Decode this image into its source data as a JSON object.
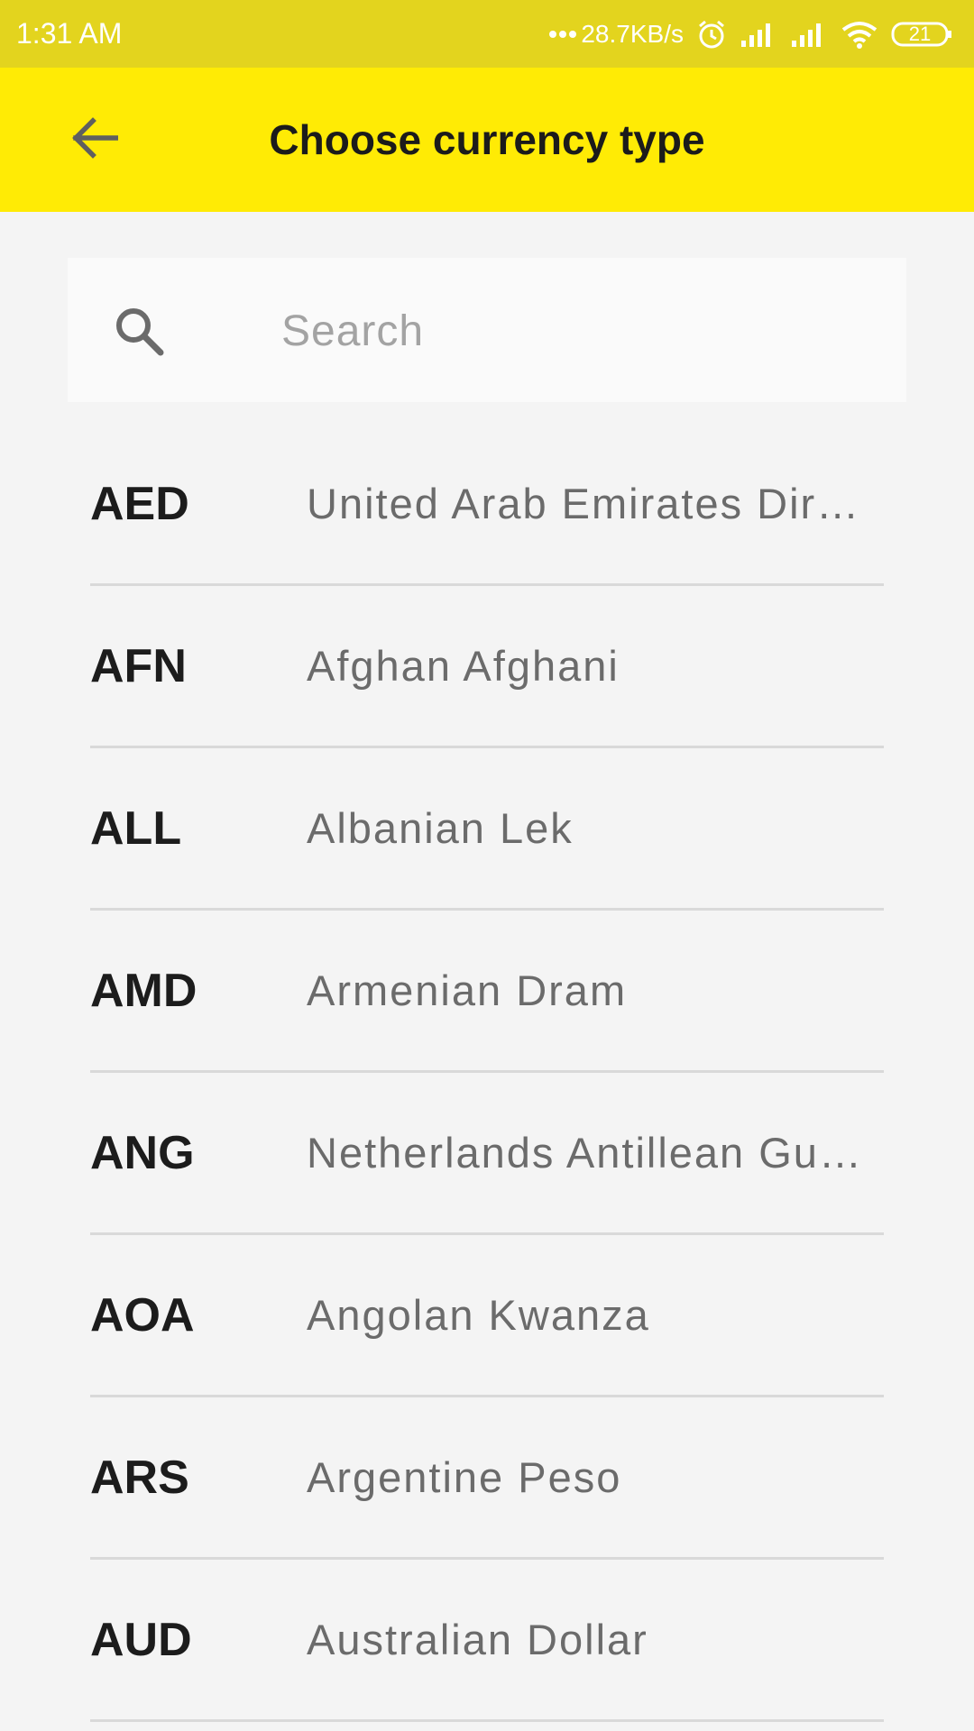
{
  "status_bar": {
    "time": "1:31 AM",
    "network_speed": "28.7KB/s",
    "battery": "21",
    "icons": [
      "dots-icon",
      "alarm-icon",
      "signal-icon",
      "signal-icon",
      "wifi-icon",
      "battery-icon"
    ]
  },
  "app_bar": {
    "title": "Choose currency type",
    "back_icon": "arrow-left-icon",
    "color": "#ffeb05"
  },
  "search": {
    "placeholder": "Search",
    "value": "",
    "icon": "search-icon"
  },
  "currencies": [
    {
      "code": "AED",
      "name": "United Arab Emirates Dir…"
    },
    {
      "code": "AFN",
      "name": "Afghan Afghani"
    },
    {
      "code": "ALL",
      "name": "Albanian Lek"
    },
    {
      "code": "AMD",
      "name": "Armenian Dram"
    },
    {
      "code": "ANG",
      "name": "Netherlands Antillean Gu…"
    },
    {
      "code": "AOA",
      "name": "Angolan Kwanza"
    },
    {
      "code": "ARS",
      "name": "Argentine Peso"
    },
    {
      "code": "AUD",
      "name": "Australian Dollar"
    }
  ]
}
